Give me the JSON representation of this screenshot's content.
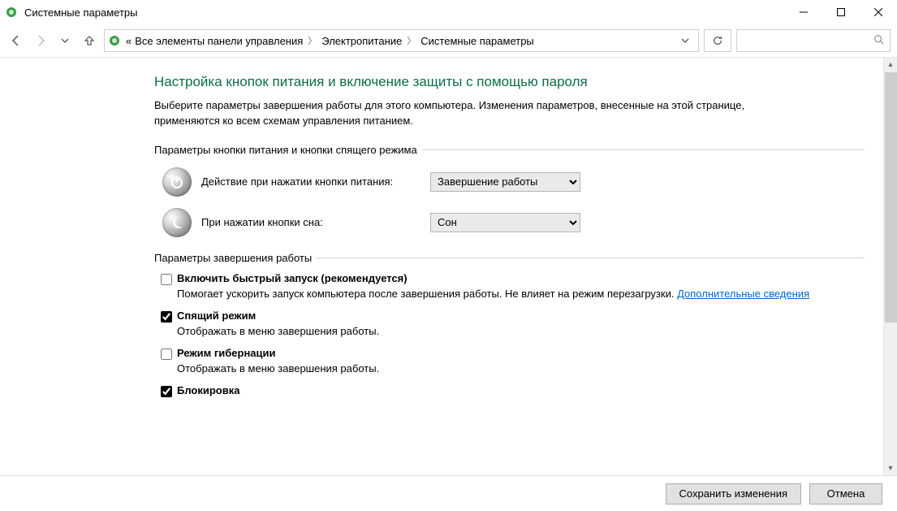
{
  "window": {
    "title": "Системные параметры"
  },
  "breadcrumbs": {
    "prefix": "«",
    "items": [
      "Все элементы панели управления",
      "Электропитание",
      "Системные параметры"
    ]
  },
  "search": {
    "placeholder": ""
  },
  "page": {
    "title": "Настройка кнопок питания и включение защиты с помощью пароля",
    "intro": "Выберите параметры завершения работы для этого компьютера. Изменения параметров, внесенные на этой странице, применяются ко всем схемам управления питанием."
  },
  "group1": {
    "legend": "Параметры кнопки питания и кнопки спящего режима",
    "power_label": "Действие при нажатии кнопки питания:",
    "power_value": "Завершение работы",
    "sleep_label": "При нажатии кнопки сна:",
    "sleep_value": "Сон"
  },
  "group2": {
    "legend": "Параметры завершения работы",
    "items": [
      {
        "checked": false,
        "title": "Включить быстрый запуск (рекомендуется)",
        "desc": "Помогает ускорить запуск компьютера после завершения работы. Не влияет на режим перезагрузки. ",
        "link": "Дополнительные сведения"
      },
      {
        "checked": true,
        "title": "Спящий режим",
        "desc": "Отображать в меню завершения работы."
      },
      {
        "checked": false,
        "title": "Режим гибернации",
        "desc": "Отображать в меню завершения работы."
      },
      {
        "checked": true,
        "title": "Блокировка",
        "desc": ""
      }
    ]
  },
  "footer": {
    "save": "Сохранить изменения",
    "cancel": "Отмена"
  }
}
